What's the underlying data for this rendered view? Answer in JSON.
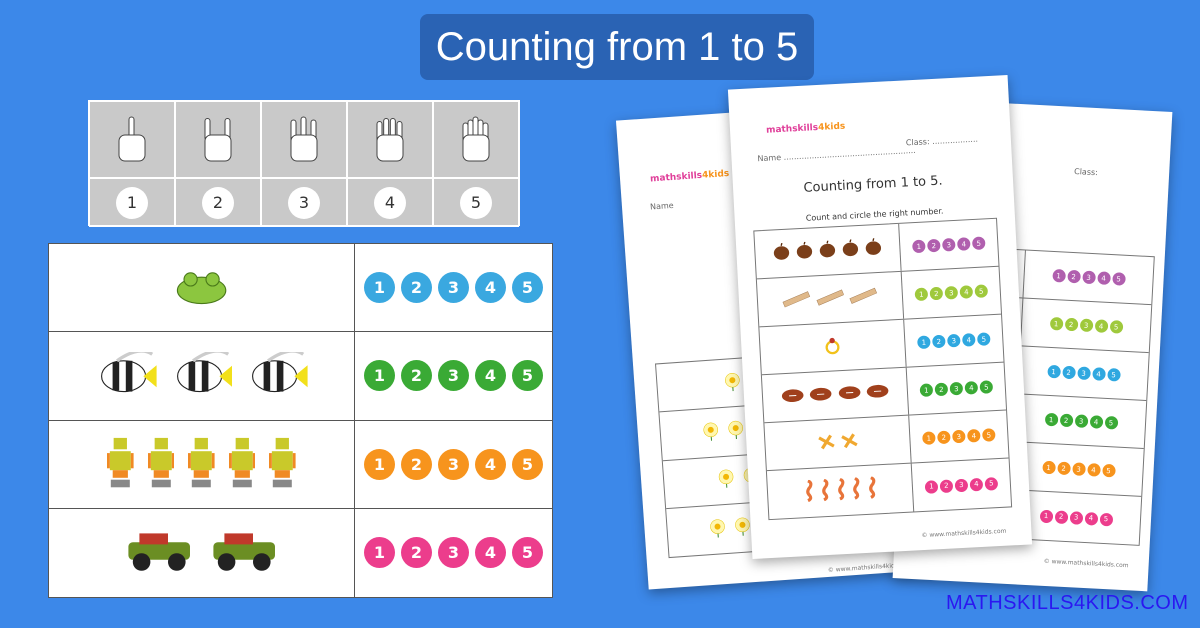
{
  "title": "Counting from 1 to 5",
  "brand": "MATHSKILLS4KIDS.COM",
  "hands": {
    "numbers": [
      "1",
      "2",
      "3",
      "4",
      "5"
    ],
    "icons": [
      "one-finger-hand-icon",
      "two-finger-hand-icon",
      "three-finger-hand-icon",
      "four-finger-hand-icon",
      "five-finger-hand-icon"
    ]
  },
  "numbers": [
    "1",
    "2",
    "3",
    "4",
    "5"
  ],
  "rows": [
    {
      "object": "frog",
      "count": 1,
      "color": "#3aa8e0",
      "objcolor": "#8cc63f"
    },
    {
      "object": "fish",
      "count": 3,
      "color": "#3aaa35",
      "objcolor": "#222222"
    },
    {
      "object": "robot",
      "count": 5,
      "color": "#f7941d",
      "objcolor": "#c9c92a"
    },
    {
      "object": "jeep",
      "count": 2,
      "color": "#ec3d8c",
      "objcolor": "#6b8e23"
    }
  ],
  "worksheet": {
    "logo_a": "mathskills",
    "logo_b": "4kids",
    "name_label": "Name",
    "class_label": "Class:",
    "title": "Counting from 1 to 5.",
    "instruction": "Count and circle the right number.",
    "footer": "© www.mathskills4kids.com",
    "rows": [
      {
        "object": "acorn",
        "count": 5,
        "color": "#b05fae",
        "objcolor": "#7b3f1a"
      },
      {
        "object": "plank",
        "count": 3,
        "color": "#9fc93c",
        "objcolor": "#e0b98a"
      },
      {
        "object": "ring",
        "count": 1,
        "color": "#2fa8e0",
        "objcolor": "#f2c21b"
      },
      {
        "object": "football",
        "count": 4,
        "color": "#3aaa35",
        "objcolor": "#a0401c"
      },
      {
        "object": "cross",
        "count": 2,
        "color": "#f7941d",
        "objcolor": "#f0a830"
      },
      {
        "object": "seahorse",
        "count": 5,
        "color": "#ec3d8c",
        "objcolor": "#e8743a"
      }
    ],
    "back_rows": [
      {
        "object": "daffodil",
        "count": 1
      },
      {
        "object": "daffodil",
        "count": 3
      },
      {
        "object": "daffodil",
        "count": 2
      },
      {
        "object": "daffodil",
        "count": 3
      }
    ]
  }
}
